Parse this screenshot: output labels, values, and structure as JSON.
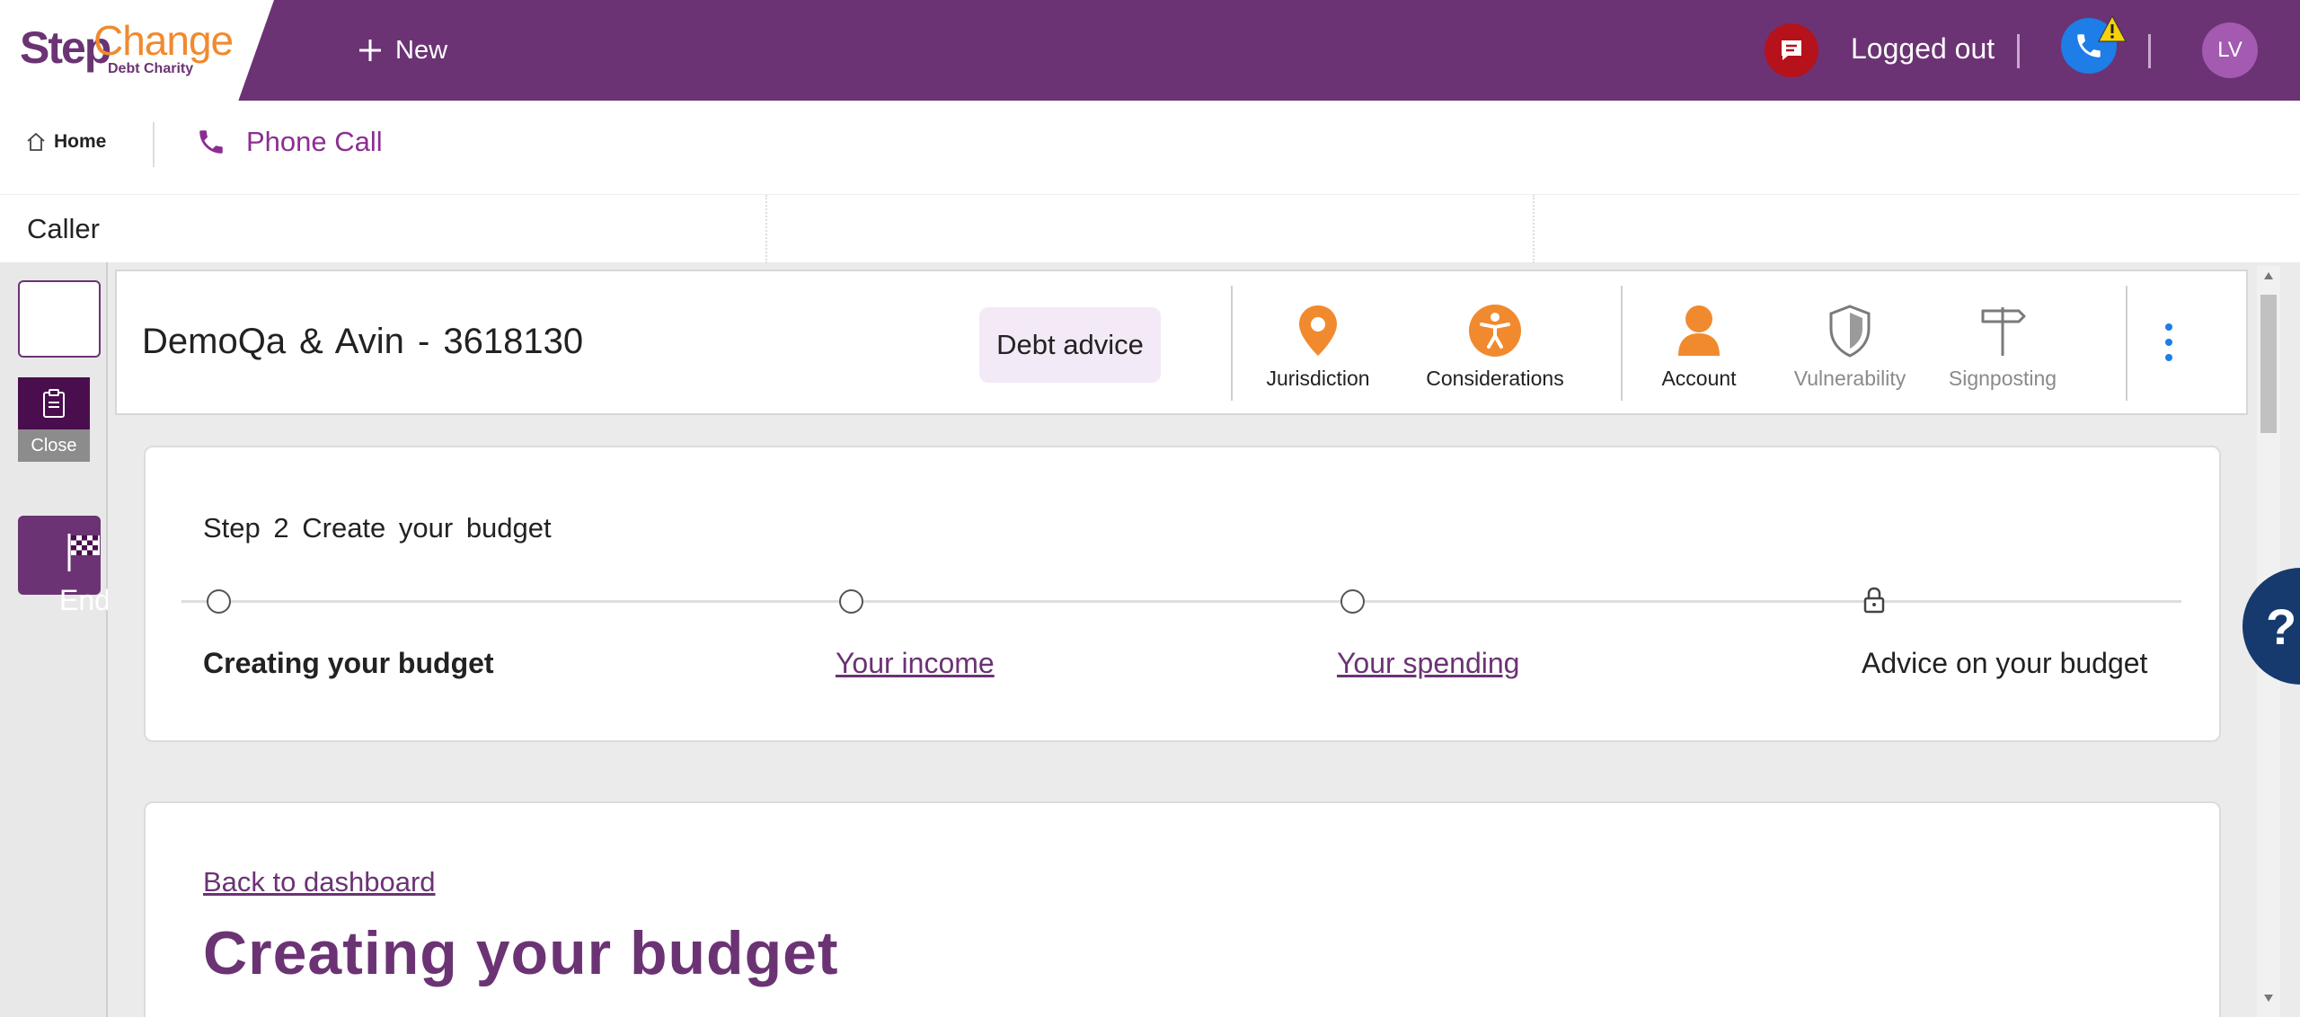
{
  "brand": {
    "logo_step": "Step",
    "logo_change": "Change",
    "logo_sub": "Debt Charity"
  },
  "topbar": {
    "new_label": "New",
    "status_text": "Logged out",
    "avatar_initials": "LV"
  },
  "tabs": {
    "home_label": "Home",
    "active_tab_label": "Phone Call"
  },
  "caller": {
    "label": "Caller"
  },
  "left_rail": {
    "close_label": "Close",
    "end_session_label": "End Session"
  },
  "case_header": {
    "title": "DemoQa & Avin - 3618130",
    "badge": "Debt advice",
    "actions": [
      {
        "label": "Jurisdiction",
        "icon": "location-pin-icon",
        "color": "#f18a2e"
      },
      {
        "label": "Considerations",
        "icon": "accessibility-icon",
        "color": "#f18a2e"
      },
      {
        "label": "Account",
        "icon": "person-icon",
        "color": "#f18a2e"
      },
      {
        "label": "Vulnerability",
        "icon": "shield-icon",
        "color": "#8a8a8a"
      },
      {
        "label": "Signposting",
        "icon": "signpost-icon",
        "color": "#8a8a8a"
      }
    ]
  },
  "progress": {
    "heading": "Step  2  Create your budget",
    "steps": [
      {
        "label": "Creating your budget",
        "state": "current"
      },
      {
        "label": "Your income",
        "state": "link"
      },
      {
        "label": "Your spending",
        "state": "link"
      },
      {
        "label": "Advice on your budget",
        "state": "locked"
      }
    ]
  },
  "content": {
    "back_link": "Back to dashboard",
    "page_title": "Creating your budget"
  },
  "help": {
    "label": "?"
  },
  "colors": {
    "brand_purple": "#6b3374",
    "brand_orange": "#f18a2e",
    "alert_red": "#b5121b",
    "phone_blue": "#1e7de6",
    "help_navy": "#163a6e"
  }
}
